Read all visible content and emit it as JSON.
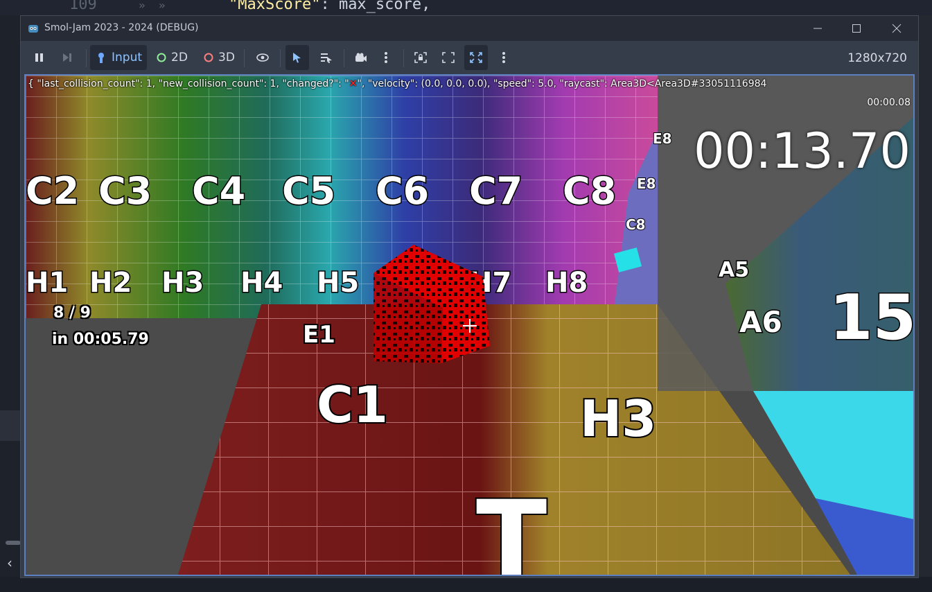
{
  "editor": {
    "line_number": "109",
    "arrows": "»  »",
    "code_key": "\"MaxScore\"",
    "code_rest": ": max_score,"
  },
  "window": {
    "title": "Smol-Jam 2023 - 2024 (DEBUG)",
    "resolution": "1280x720"
  },
  "toolbar": {
    "input_label": "Input",
    "twod_label": "2D",
    "threed_label": "3D"
  },
  "hud": {
    "debug_prefix": "{ \"last_collision_count\": 1, \"new_collision_count\": 1, \"changed?\": \"",
    "debug_x": "✕",
    "debug_suffix": "\", \"velocity\": (0.0, 0.0, 0.0), \"speed\": 5.0, \"raycast\": Area3D<Area3D#33051116984",
    "small_timer": "00:00.08",
    "big_timer": "00:13.70",
    "progress": "8 / 9",
    "split_time": "in 00:05.79"
  },
  "scene": {
    "wall_labels_row1": [
      "C2",
      "C3",
      "C4",
      "C5",
      "C6",
      "C7",
      "C8"
    ],
    "wall_labels_row2": [
      "H1",
      "H2",
      "H3",
      "H4",
      "H5",
      "H7",
      "H8"
    ],
    "side_labels": [
      "E8",
      "E8",
      "C8"
    ],
    "floor_labels": [
      "C1",
      "H3",
      "E1",
      "T"
    ],
    "right_labels": [
      "A6",
      "15",
      "A5"
    ]
  },
  "colors": {
    "accent": "#5b7fbf",
    "titlebar": "#262b35",
    "toolbar": "#363d4a"
  }
}
